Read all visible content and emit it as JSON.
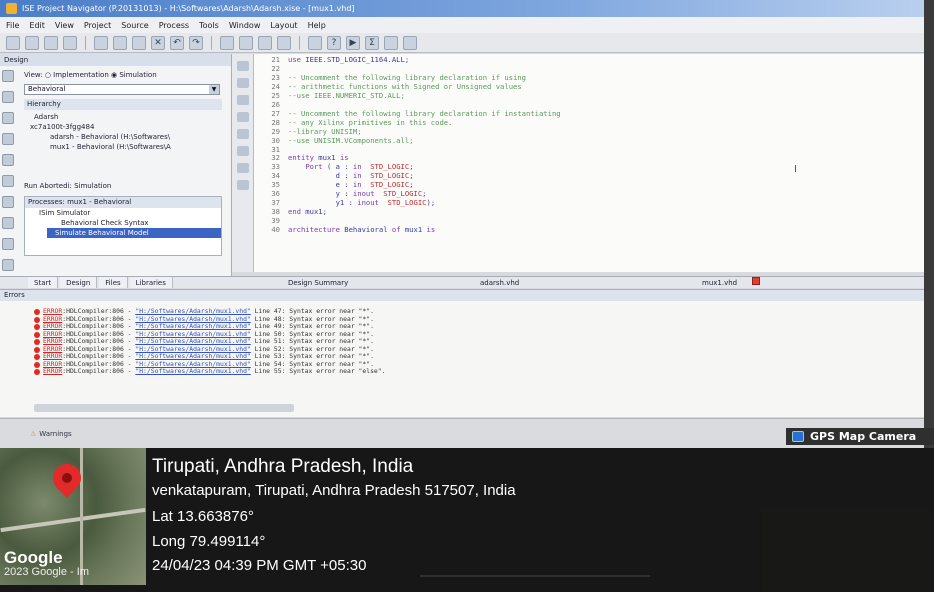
{
  "window": {
    "title": "ISE Project Navigator (P.20131013) - H:\\Softwares\\Adarsh\\Adarsh.xise - [mux1.vhd]"
  },
  "menu": [
    "File",
    "Edit",
    "View",
    "Project",
    "Source",
    "Process",
    "Tools",
    "Window",
    "Layout",
    "Help"
  ],
  "design_panel": {
    "header": "Design",
    "view_label": "View:",
    "view_impl": "Implementation",
    "view_sim": "Simulation",
    "combo_value": "Behavioral",
    "hierarchy_title": "Hierarchy",
    "tree": [
      "Adarsh",
      "xc7a100t-3fgg484",
      "adarsh - Behavioral (H:\\Softwares\\",
      "mux1 - Behavioral (H:\\Softwares\\A"
    ],
    "run_label": "Run Abortedi: Simulation",
    "processes_title": "Processes: mux1 - Behavioral",
    "processes": [
      "ISim Simulator",
      "Behavioral Check Syntax",
      "Simulate Behavioral Model"
    ]
  },
  "left_tabs": [
    "Start",
    "Design",
    "Files",
    "Libraries"
  ],
  "editor": {
    "line_numbers": [
      "21",
      "22",
      "23",
      "24",
      "25",
      "26",
      "27",
      "28",
      "29",
      "30",
      "31",
      "32",
      "33",
      "34",
      "35",
      "36",
      "37",
      "38",
      "39",
      "40"
    ],
    "tabs": [
      "Design Summary",
      "adarsh.vhd",
      "mux1.vhd"
    ]
  },
  "errors_panel": {
    "title": "Errors",
    "rows": [
      {
        "label": "ERROR",
        "code": ":HDLCompiler:806 - ",
        "path": "\"H:/Softwares/Adarsh/mux1.vhd\"",
        "msg": " Line 47: Syntax error near \"*\"."
      },
      {
        "label": "ERROR",
        "code": ":HDLCompiler:806 - ",
        "path": "\"H:/Softwares/Adarsh/mux1.vhd\"",
        "msg": " Line 48: Syntax error near \"*\"."
      },
      {
        "label": "ERROR",
        "code": ":HDLCompiler:806 - ",
        "path": "\"H:/Softwares/Adarsh/mux1.vhd\"",
        "msg": " Line 49: Syntax error near \"*\"."
      },
      {
        "label": "ERROR",
        "code": ":HDLCompiler:806 - ",
        "path": "\"H:/Softwares/Adarsh/mux1.vhd\"",
        "msg": " Line 50: Syntax error near \"*\"."
      },
      {
        "label": "ERROR",
        "code": ":HDLCompiler:806 - ",
        "path": "\"H:/Softwares/Adarsh/mux1.vhd\"",
        "msg": " Line 51: Syntax error near \"*\"."
      },
      {
        "label": "ERROR",
        "code": ":HDLCompiler:806 - ",
        "path": "\"H:/Softwares/Adarsh/mux1.vhd\"",
        "msg": " Line 52: Syntax error near \"*\"."
      },
      {
        "label": "ERROR",
        "code": ":HDLCompiler:806 - ",
        "path": "\"H:/Softwares/Adarsh/mux1.vhd\"",
        "msg": " Line 53: Syntax error near \"*\"."
      },
      {
        "label": "ERROR",
        "code": ":HDLCompiler:806 - ",
        "path": "\"H:/Softwares/Adarsh/mux1.vhd\"",
        "msg": " Line 54: Syntax error near \"*\"."
      },
      {
        "label": "ERROR",
        "code": ":HDLCompiler:806 - ",
        "path": "\"H:/Softwares/Adarsh/mux1.vhd\"",
        "msg": " Line 55: Syntax error near \"else\"."
      }
    ],
    "warnings_tab": "Warnings"
  },
  "gps": {
    "badge": "GPS Map Camera",
    "city": "Tirupati, Andhra Pradesh, India",
    "address": "venkatapuram, Tirupati, Andhra Pradesh 517507, India",
    "lat": "Lat 13.663876°",
    "long": "Long 79.499114°",
    "datetime": "24/04/23 04:39 PM GMT +05:30",
    "map_brand": "Google",
    "map_copy": "2023 Google - Im"
  }
}
